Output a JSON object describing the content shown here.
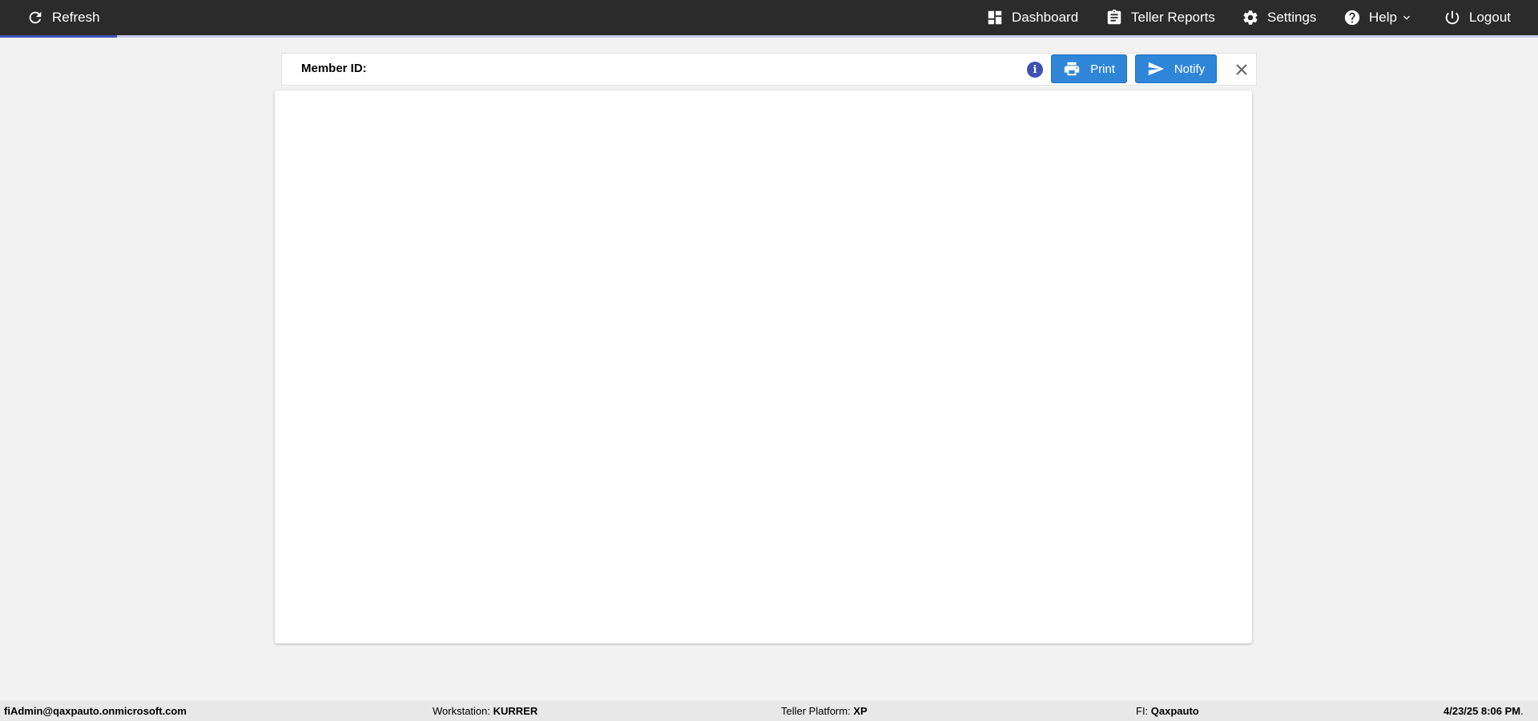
{
  "nav": {
    "refresh_label": "Refresh",
    "dashboard_label": "Dashboard",
    "teller_reports_label": "Teller Reports",
    "settings_label": "Settings",
    "help_label": "Help",
    "logout_label": "Logout",
    "progress_fraction": 0.076
  },
  "header": {
    "member_id_label": "Member ID:",
    "info_icon": "i",
    "print_label": "Print",
    "notify_label": "Notify"
  },
  "footer": {
    "user": "fiAdmin@qaxpauto.onmicrosoft.com",
    "workstation_label": "Workstation: ",
    "workstation_value": "KURRER",
    "platform_label": "Teller Platform: ",
    "platform_value": "XP",
    "fi_label": "FI: ",
    "fi_value": "Qaxpauto",
    "datetime": "4/23/25 8:06 PM"
  },
  "colors": {
    "topbar": "#2b2b2b",
    "accent": "#3f51b5",
    "button": "#2f86d9"
  },
  "icons": [
    "refresh-icon",
    "dashboard-icon",
    "clipboard-icon",
    "gear-icon",
    "help-icon",
    "chevron-down-icon",
    "power-icon",
    "info-icon",
    "printer-icon",
    "send-icon",
    "close-icon"
  ]
}
